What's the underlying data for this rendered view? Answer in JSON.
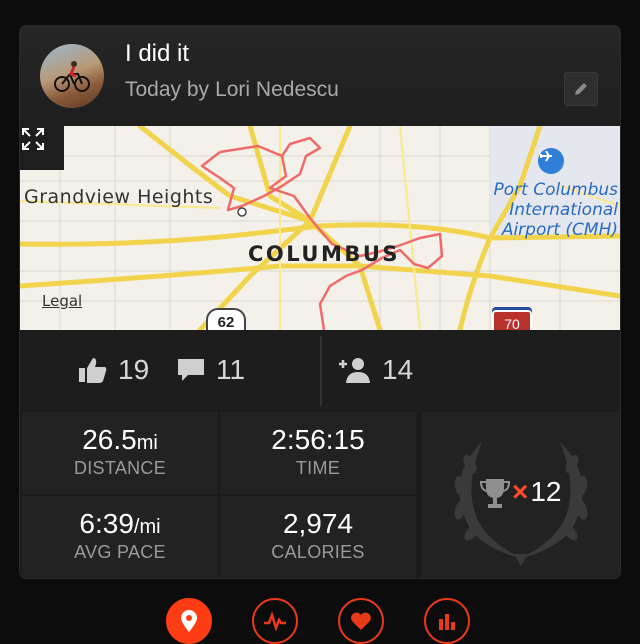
{
  "activity": {
    "title": "I did it",
    "subtitle_prefix": "Today by",
    "author": "Lori Nedescu"
  },
  "map": {
    "labels": {
      "grandview": "Grandview Heights",
      "columbus": "COLUMBUS",
      "airport_line1": "Port Columbus",
      "airport_line2": "International",
      "airport_line3": "Airport (CMH)",
      "legal": "Legal"
    },
    "route_shields": {
      "us_route": "62",
      "interstate": "70"
    },
    "route_color": "#f06a6a"
  },
  "social": {
    "likes": "19",
    "comments": "11",
    "followers": "14"
  },
  "stats": {
    "distance": {
      "value": "26.5",
      "unit": "mi",
      "label": "DISTANCE"
    },
    "time": {
      "value": "2:56:15",
      "label": "TIME"
    },
    "pace": {
      "value": "6:39",
      "unit": "/mi",
      "label": "AVG PACE"
    },
    "calories": {
      "value": "2,974",
      "label": "CALORIES"
    }
  },
  "trophies": {
    "multiplier_symbol": "×",
    "count": "12"
  },
  "bottom_nav": [
    {
      "icon": "map-pin-icon",
      "active": true
    },
    {
      "icon": "pulse-icon",
      "active": false
    },
    {
      "icon": "heart-icon",
      "active": false
    },
    {
      "icon": "bar-chart-icon",
      "active": false
    }
  ],
  "colors": {
    "accent": "#ff3d14",
    "background": "#0c0c0c"
  }
}
